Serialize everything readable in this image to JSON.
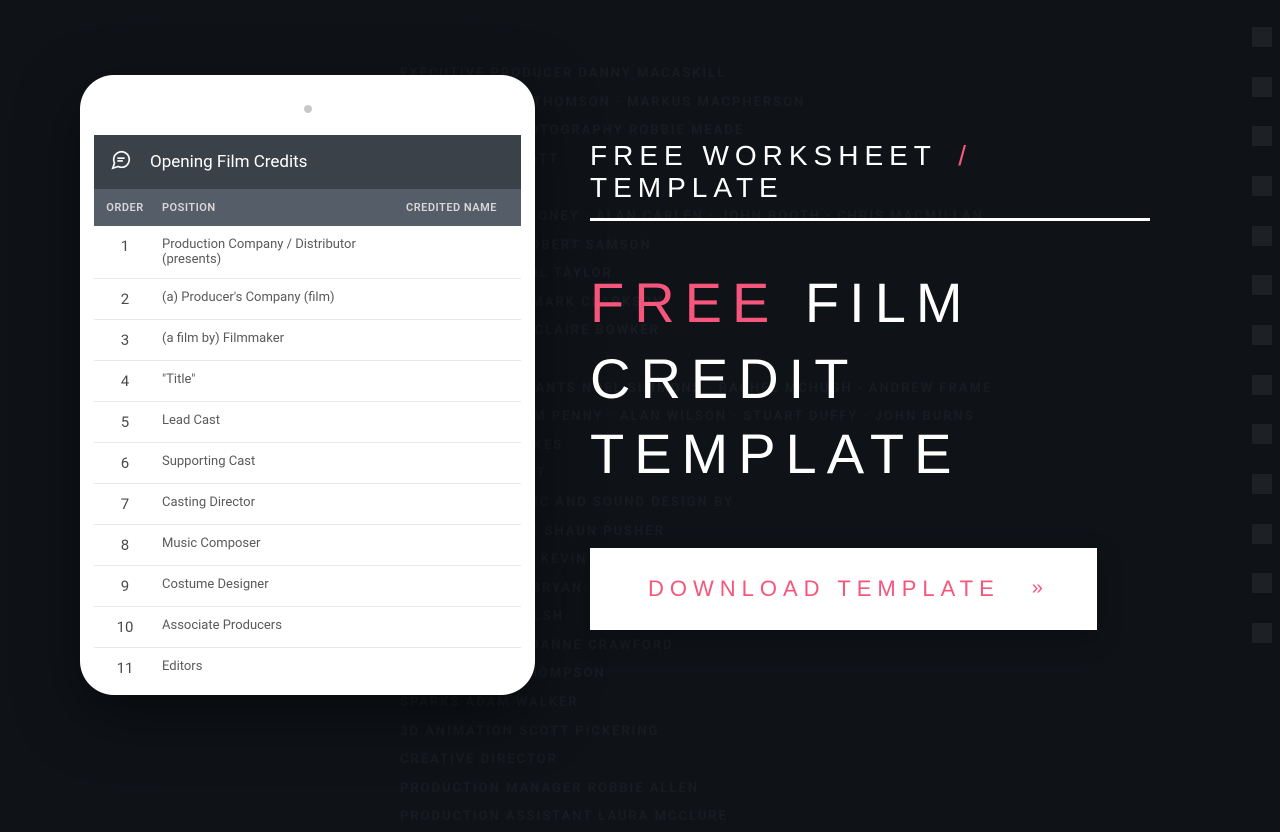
{
  "eyebrow": {
    "pre": "Free Worksheet",
    "slash": "/",
    "post": "Template"
  },
  "headline": {
    "accent": "Free",
    "rest_line1": "Film Credit",
    "line2": "Template"
  },
  "cta": {
    "label": "Download Template",
    "chevrons": "»"
  },
  "table": {
    "title": "Opening Film Credits",
    "headers": {
      "order": "ORDER",
      "position": "POSITION",
      "name": "CREDITED NAME"
    },
    "rows": [
      {
        "order": "1",
        "position": "Production Company / Distributor (presents)",
        "name": ""
      },
      {
        "order": "2",
        "position": "(a) Producer's Company (film)",
        "name": ""
      },
      {
        "order": "3",
        "position": "(a film by) Filmmaker",
        "name": ""
      },
      {
        "order": "4",
        "position": "\"Title\"",
        "name": ""
      },
      {
        "order": "5",
        "position": "Lead Cast",
        "name": ""
      },
      {
        "order": "6",
        "position": "Supporting Cast",
        "name": ""
      },
      {
        "order": "7",
        "position": "Casting Director",
        "name": ""
      },
      {
        "order": "8",
        "position": "Music Composer",
        "name": ""
      },
      {
        "order": "9",
        "position": "Costume Designer",
        "name": ""
      },
      {
        "order": "10",
        "position": "Associate Producers",
        "name": ""
      },
      {
        "order": "11",
        "position": "Editors",
        "name": ""
      }
    ]
  },
  "bg_text": "EXECUTIVE PRODUCER   DANNY MACASKILL\nPRODUCERS   STU THOMSON · MARKUS MACPHERSON\nDIRECTOR OF PHOTOGRAPHY   ROBBIE MEADE\nEDITOR   JIM ELLIOTT\nSOUND MIXER\nCAMERA   RAY MALONEY · ALAN CARLEN · JOHN BOOTH · CHRIS MACMILLAN\nFOCUS PULLER   ROBERT SAMSON\nCAMERA GRIP   PHIL TAYLOR\nAERIAL FILMING   MARK CLARKSON\nCOSTUME   MARIE CLAIRE BOWKER\nART DIRECTOR\nCOSTUME ASSISTANTS   NOEL SIMMONS · RACHEL MCHUGH · ANDREW FRAME\nPROPS BUYER   TOM PENNY · ALAN WILSON · STUART DUFFY · JOHN BURNS\nPROPS   MATT WILKES\nRIDING ASSISTANT\nADDITIONAL MUSIC AND SOUND DESIGN BY\nDRONE OPERATOR   SHAUN PUSHER\nSOUND DESIGNER   KEVIN BOAST\n2ND UNIT   CRAIG BRYAN · CHRIS HALL\nMAKE UP   JEN WALSH\nASST MAKE UP   JOANNE CRAWFORD\nGAFFER   CRAIG THOMPSON\nSPARKS   ADAM WALKER\n3D ANIMATION   SCOTT PICKERING\nCREATIVE DIRECTOR\nPRODUCTION MANAGER   ROBBIE ALLEN\nPRODUCTION ASSISTANT   LAURA MCCLURE"
}
